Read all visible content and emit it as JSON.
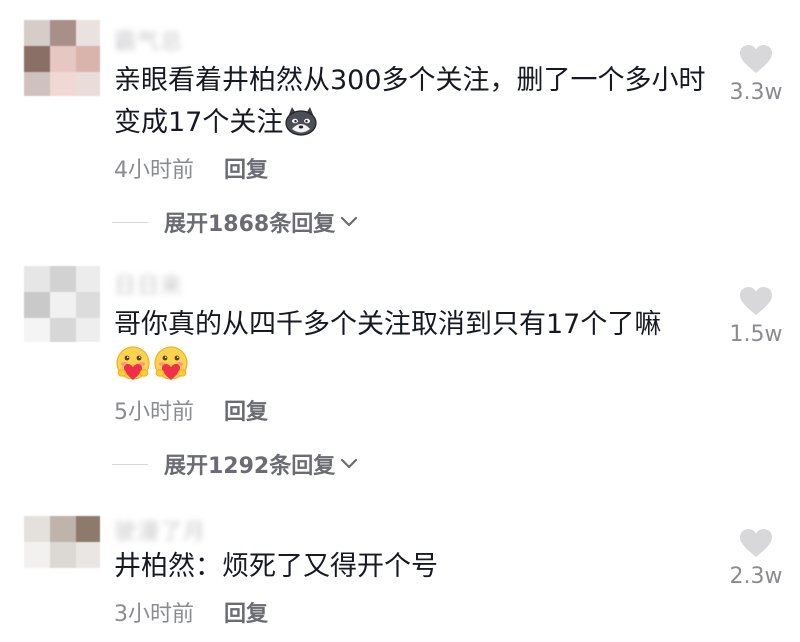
{
  "comments": [
    {
      "username": "霸气总",
      "text": "亲眼看着井柏然从300多个关注，删了一个多小时变成17个关注",
      "emoji": "husky-emoji",
      "time": "4小时前",
      "reply": "回复",
      "expand": "展开1868条回复",
      "likes": "3.3w"
    },
    {
      "username": "日日来",
      "text": "哥你真的从四千多个关注取消到只有17个了嘛",
      "emoji": "heart-hug-emoji",
      "time": "5小时前",
      "reply": "回复",
      "expand": "展开1292条回复",
      "likes": "1.5w"
    },
    {
      "username": "驶漫了月",
      "text": "井柏然：烦死了又得开个号",
      "time": "3小时前",
      "reply": "回复",
      "likes": "2.3w"
    }
  ],
  "colors": {
    "text": "#161823",
    "meta": "#8a8b91",
    "heart": "#d8d8db"
  }
}
